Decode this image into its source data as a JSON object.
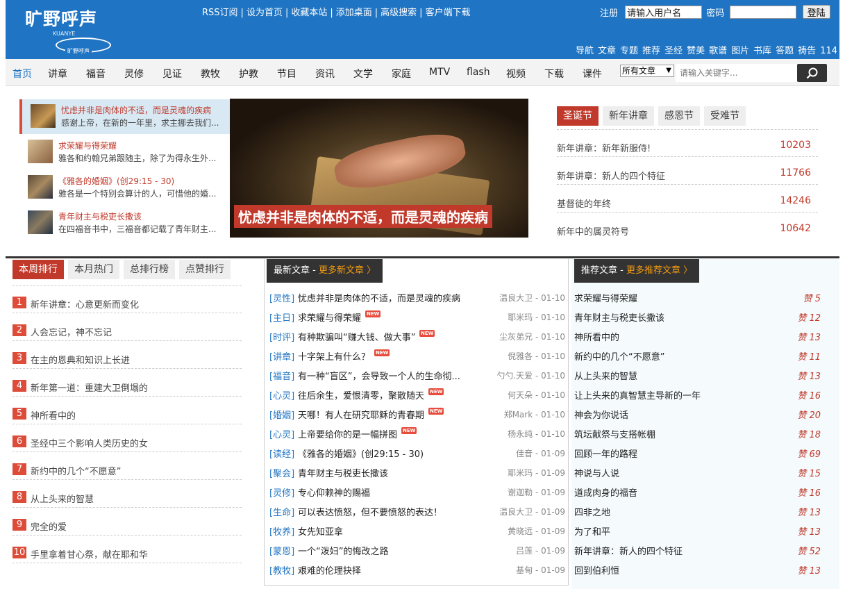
{
  "header": {
    "logo_text": "旷野呼声",
    "logo_sub": "KUANYE",
    "logo_mark": "旷野呼声",
    "top_links": [
      "RSS订阅",
      "设为首页",
      "收藏本站",
      "添加桌面",
      "高级搜索",
      "客户端下载"
    ],
    "login": {
      "register": "注册",
      "username_placeholder": "请输入用户名",
      "password_label": "密码",
      "login_button": "登陆"
    },
    "sub_nav": [
      "导航",
      "文章",
      "专题",
      "推荐",
      "圣经",
      "赞美",
      "歌谱",
      "图片",
      "书库",
      "答题",
      "祷告",
      "114"
    ]
  },
  "main_nav": [
    "首页",
    "讲章",
    "福音",
    "灵修",
    "见证",
    "教牧",
    "护教",
    "节目",
    "资讯",
    "文学",
    "家庭",
    "MTV",
    "flash",
    "视频",
    "下载",
    "课件"
  ],
  "search": {
    "category": "所有文章",
    "placeholder": "请输入关键字..."
  },
  "hero": {
    "items": [
      {
        "title": "忧虑并非是肉体的不适，而是灵魂的疾病",
        "desc": "感谢上帝，在新的一年里，求主挪去我们..."
      },
      {
        "title": "求荣耀与得荣耀",
        "desc": "雅各和约翰兄弟跟随主，除了为得永生外..."
      },
      {
        "title": "《雅各的婚姻》(创29:15 - 30)",
        "desc": "雅各是一个特别会算计的人，可惜他的婚..."
      },
      {
        "title": "青年财主与税吏长撒该",
        "desc": "在四福音书中，三福音都记载了青年财主..."
      }
    ],
    "caption": "忧虑并非是肉体的不适，而是灵魂的疾病"
  },
  "festival": {
    "tabs": [
      "圣诞节",
      "新年讲章",
      "感恩节",
      "受难节"
    ],
    "rows": [
      {
        "title": "新年讲章：新年新服侍!",
        "count": "10203"
      },
      {
        "title": "新年讲章：新人的四个特征",
        "count": "11766"
      },
      {
        "title": "基督徒的年终",
        "count": "14246"
      },
      {
        "title": "新年中的属灵符号",
        "count": "10642"
      }
    ]
  },
  "ranking": {
    "tabs": [
      "本周排行",
      "本月热门",
      "总排行榜",
      "点赞排行"
    ],
    "items": [
      {
        "num": "1",
        "title": "新年讲章：心意更新而变化"
      },
      {
        "num": "2",
        "title": "人会忘记，神不忘记"
      },
      {
        "num": "3",
        "title": "在主的恩典和知识上长进"
      },
      {
        "num": "4",
        "title": "新年第一道：重建大卫倒塌的"
      },
      {
        "num": "5",
        "title": "神所看中的"
      },
      {
        "num": "6",
        "title": "圣经中三个影响人类历史的女"
      },
      {
        "num": "7",
        "title": "新约中的几个“不愿意”"
      },
      {
        "num": "8",
        "title": "从上头来的智慧"
      },
      {
        "num": "9",
        "title": "完全的爱"
      },
      {
        "num": "10",
        "title": "手里拿着甘心祭，献在耶和华"
      }
    ]
  },
  "latest": {
    "heading": "最新文章",
    "sep": " - ",
    "more": "更多新文章 〉",
    "new_badge": "NEW",
    "items": [
      {
        "cat": "[灵性]",
        "title": "忧虑并非是肉体的不适，而是灵魂的疾病",
        "meta": "温良大卫 - 01-10",
        "is_new": false
      },
      {
        "cat": "[主日]",
        "title": "求荣耀与得荣耀",
        "meta": "耶米玛 - 01-10",
        "is_new": true
      },
      {
        "cat": "[时评]",
        "title": "有种欺骗叫“赚大钱、做大事”",
        "meta": "尘灰弟兄 - 01-10",
        "is_new": true
      },
      {
        "cat": "[讲章]",
        "title": "十字架上有什么？",
        "meta": "倪雅各 - 01-10",
        "is_new": true
      },
      {
        "cat": "[福音]",
        "title": "有一种“盲区”，会导致一个人的生命彻...",
        "meta": "勺勺.天爱 - 01-10",
        "is_new": false
      },
      {
        "cat": "[心灵]",
        "title": "往后余生，爱恨清零，聚散随天",
        "meta": "何天朵 - 01-10",
        "is_new": true
      },
      {
        "cat": "[婚姻]",
        "title": "天哪！有人在研究耶稣的青春期",
        "meta": "郑Mark - 01-10",
        "is_new": true
      },
      {
        "cat": "[心灵]",
        "title": "上帝要给你的是一幅拼图",
        "meta": "杨永纯 - 01-10",
        "is_new": true
      },
      {
        "cat": "[读经]",
        "title": "《雅各的婚姻》(创29:15 - 30)",
        "meta": "佳音 - 01-09",
        "is_new": false
      },
      {
        "cat": "[聚会]",
        "title": "青年财主与税吏长撒该",
        "meta": "耶米玛 - 01-09",
        "is_new": false
      },
      {
        "cat": "[灵修]",
        "title": "专心仰赖神的赐福",
        "meta": "谢迦勒 - 01-09",
        "is_new": false
      },
      {
        "cat": "[生命]",
        "title": "可以表达愤怒，但不要愤怒的表达！",
        "meta": "温良大卫 - 01-09",
        "is_new": false
      },
      {
        "cat": "[牧养]",
        "title": "女先知亚拿",
        "meta": "黄晓远 - 01-09",
        "is_new": false
      },
      {
        "cat": "[蒙恩]",
        "title": "一个“泼妇”的悔改之路",
        "meta": "吕莲 - 01-09",
        "is_new": false
      },
      {
        "cat": "[教牧]",
        "title": "艰难的伦理抉择",
        "meta": "基甸 - 01-09",
        "is_new": false
      }
    ]
  },
  "recommended": {
    "heading": "推荐文章",
    "sep": " - ",
    "more": "更多推荐文章 〉",
    "items": [
      {
        "title": "求荣耀与得荣耀",
        "likes": "赞 5"
      },
      {
        "title": "青年财主与税吏长撒该",
        "likes": "赞 12"
      },
      {
        "title": "神所看中的",
        "likes": "赞 13"
      },
      {
        "title": "新约中的几个“不愿意”",
        "likes": "赞 11"
      },
      {
        "title": "从上头来的智慧",
        "likes": "赞 13"
      },
      {
        "title": "让上头来的真智慧主导新的一年",
        "likes": "赞 16"
      },
      {
        "title": "神会为你说话",
        "likes": "赞 20"
      },
      {
        "title": "筑坛献祭与支搭帐棚",
        "likes": "赞 18"
      },
      {
        "title": "回顾一年的路程",
        "likes": "赞 69"
      },
      {
        "title": "神说与人说",
        "likes": "赞 15"
      },
      {
        "title": "道成肉身的福音",
        "likes": "赞 16"
      },
      {
        "title": "四非之地",
        "likes": "赞 13"
      },
      {
        "title": "为了和平",
        "likes": "赞 13"
      },
      {
        "title": "新年讲章：新人的四个特征",
        "likes": "赞 52"
      },
      {
        "title": "回到伯利恒",
        "likes": "赞 13"
      }
    ]
  },
  "colors": {
    "header_blue": "#1f74c3",
    "accent_red": "#c0392b",
    "link_blue": "#1f74c3",
    "more_orange": "#f39c12"
  }
}
